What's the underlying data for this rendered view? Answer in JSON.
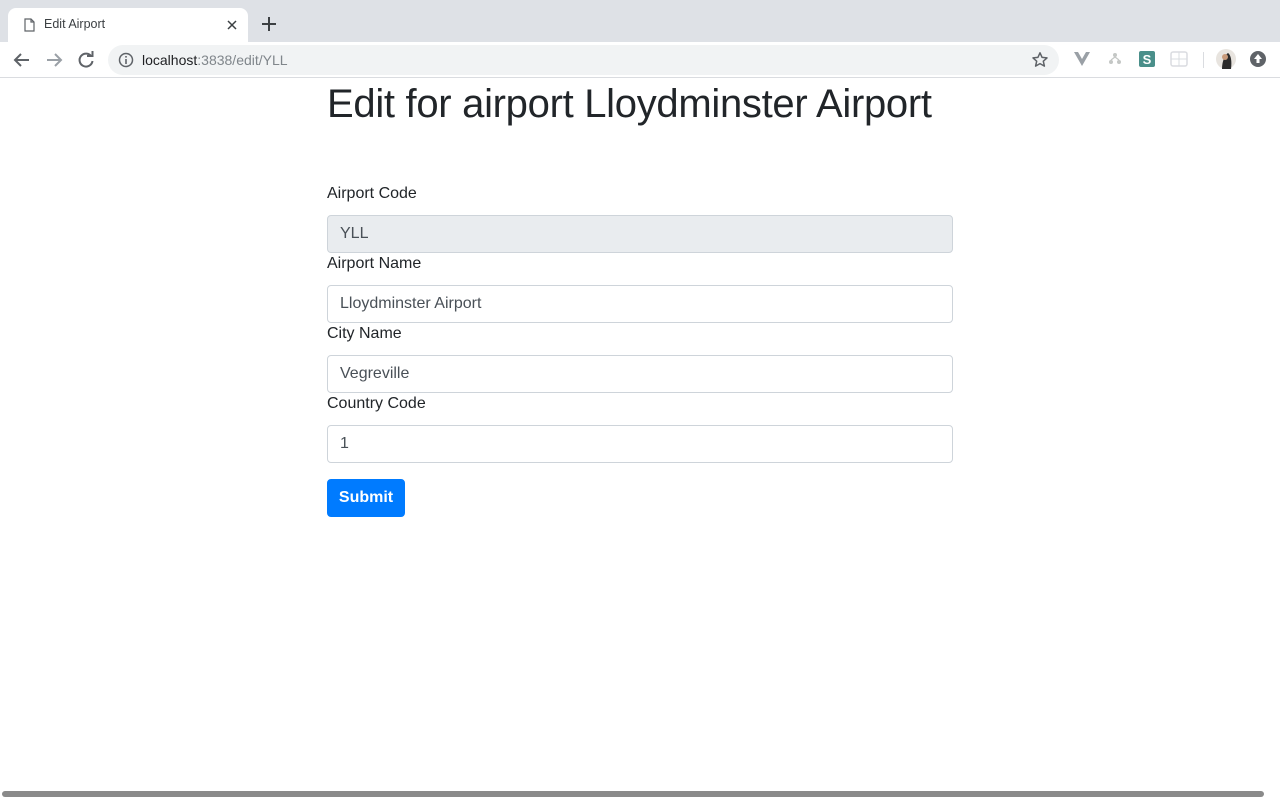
{
  "browser": {
    "tab_title": "Edit Airport",
    "url_host": "localhost",
    "url_path": ":3838/edit/YLL"
  },
  "page": {
    "title": "Edit for airport Lloydminster Airport"
  },
  "form": {
    "airport_code_label": "Airport Code",
    "airport_code_value": "YLL",
    "airport_name_label": "Airport Name",
    "airport_name_value": "Lloydminster Airport",
    "city_name_label": "City Name",
    "city_name_value": "Vegreville",
    "country_code_label": "Country Code",
    "country_code_value": "1",
    "submit_label": "Submit"
  },
  "colors": {
    "primary": "#007bff",
    "readonly_bg": "#e9ecef",
    "text": "#212529"
  },
  "icons": [
    "document-icon",
    "close-icon",
    "plus-icon",
    "back-arrow-icon",
    "forward-arrow-icon",
    "reload-icon",
    "info-icon",
    "star-icon",
    "vue-devtools-icon",
    "extension-tree-icon",
    "extension-s-icon",
    "extension-grid-icon",
    "avatar",
    "extension-upload-icon"
  ]
}
